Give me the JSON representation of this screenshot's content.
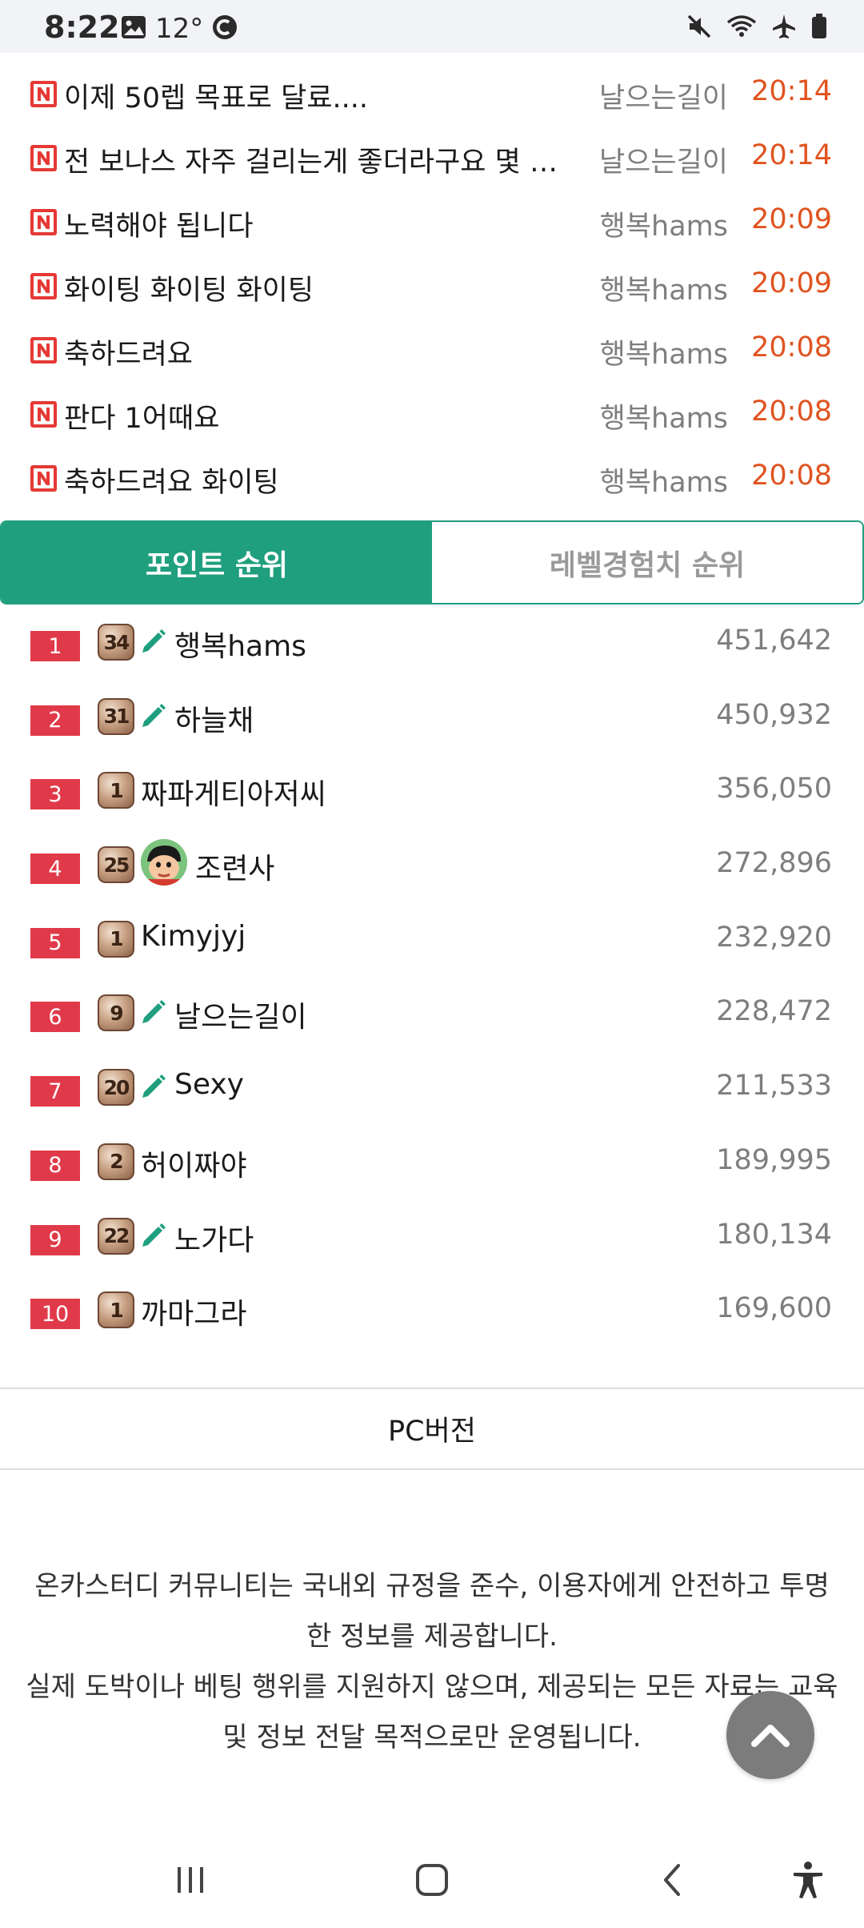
{
  "status_bar": {
    "time": "8:22",
    "temperature": "12°",
    "left_icons": [
      "gallery-icon",
      "c-circle-icon"
    ],
    "right_icons": [
      "mute-icon",
      "wifi-icon",
      "airplane-icon",
      "battery-icon"
    ]
  },
  "recent_posts": [
    {
      "title": "이제 50렙 목표로 달료....",
      "author": "날으는길이",
      "time": "20:14"
    },
    {
      "title": "전 보나스 자주 걸리는게 좋더라구요 몇 천…",
      "author": "날으는길이",
      "time": "20:14"
    },
    {
      "title": "노력해야 됩니다",
      "author": "행복hams",
      "time": "20:09"
    },
    {
      "title": "화이팅 화이팅 화이팅",
      "author": "행복hams",
      "time": "20:09"
    },
    {
      "title": "축하드려요",
      "author": "행복hams",
      "time": "20:08"
    },
    {
      "title": "판다 1어때요",
      "author": "행복hams",
      "time": "20:08"
    },
    {
      "title": "축하드려요 화이팅",
      "author": "행복hams",
      "time": "20:08"
    }
  ],
  "tabs": [
    {
      "label": "포인트 순위",
      "active": true
    },
    {
      "label": "레벨경험치 순위",
      "active": false
    }
  ],
  "ranking": [
    {
      "rank": "1",
      "level": "34",
      "marker": "pencil",
      "name": "행복hams",
      "points": "451,642"
    },
    {
      "rank": "2",
      "level": "31",
      "marker": "pencil",
      "name": "하늘채",
      "points": "450,932"
    },
    {
      "rank": "3",
      "level": "1",
      "marker": "none",
      "name": "짜파게티아저씨",
      "points": "356,050"
    },
    {
      "rank": "4",
      "level": "25",
      "marker": "avatar",
      "name": "조련사",
      "points": "272,896"
    },
    {
      "rank": "5",
      "level": "1",
      "marker": "none",
      "name": "Kimyjyj",
      "points": "232,920"
    },
    {
      "rank": "6",
      "level": "9",
      "marker": "pencil",
      "name": "날으는길이",
      "points": "228,472"
    },
    {
      "rank": "7",
      "level": "20",
      "marker": "pencil",
      "name": "Sexy",
      "points": "211,533"
    },
    {
      "rank": "8",
      "level": "2",
      "marker": "none",
      "name": "허이짜야",
      "points": "189,995"
    },
    {
      "rank": "9",
      "level": "22",
      "marker": "pencil",
      "name": "노가다",
      "points": "180,134"
    },
    {
      "rank": "10",
      "level": "1",
      "marker": "none",
      "name": "까마그라",
      "points": "169,600"
    }
  ],
  "pc_version_label": "PC버전",
  "notice": {
    "line1": "온카스터디 커뮤니티는 국내외 규정을 준수, 이용자에게 안전하고 투명한 정보를 제공합니다.",
    "line2": "실제 도박이나 베팅 행위를 지원하지 않으며, 제공되는 모든 자료는 교육 및 정보 전달 목적으로만 운영됩니다."
  },
  "colors": {
    "accent_green": "#1f9f7e",
    "rank_red": "#e03a4a",
    "time_orange": "#e0531f",
    "new_badge_red": "#e53935"
  },
  "nav_bar": [
    "recent-apps-icon",
    "home-icon",
    "back-icon",
    "accessibility-icon"
  ]
}
